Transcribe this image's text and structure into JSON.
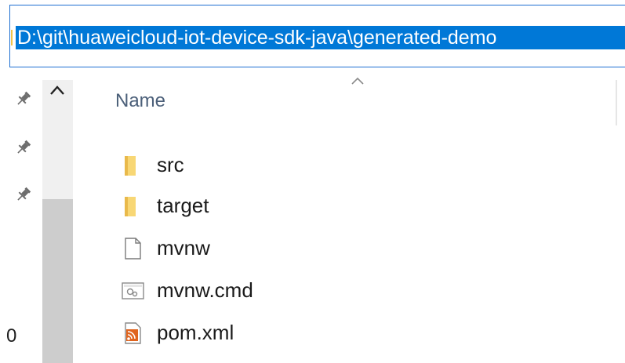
{
  "address_bar": {
    "path": "D:\\git\\huaweicloud-iot-device-sdk-java\\generated-demo"
  },
  "nav_pane": {
    "pins": [
      "pin-icon",
      "pin-icon",
      "pin-icon"
    ],
    "partial_label": "0"
  },
  "file_list": {
    "column_header": "Name",
    "sort_icon": "chevron-up-icon",
    "items": [
      {
        "name": "src",
        "icon": "folder-icon"
      },
      {
        "name": "target",
        "icon": "folder-icon"
      },
      {
        "name": "mvnw",
        "icon": "file-icon"
      },
      {
        "name": "mvnw.cmd",
        "icon": "cmd-file-icon"
      },
      {
        "name": "pom.xml",
        "icon": "rss-xml-icon"
      }
    ]
  },
  "colors": {
    "selection": "#0078d7",
    "address_border": "#1e6fd2",
    "folder": "#f8d775",
    "header_text": "#4c607a",
    "xml_icon": "#e0641e"
  }
}
